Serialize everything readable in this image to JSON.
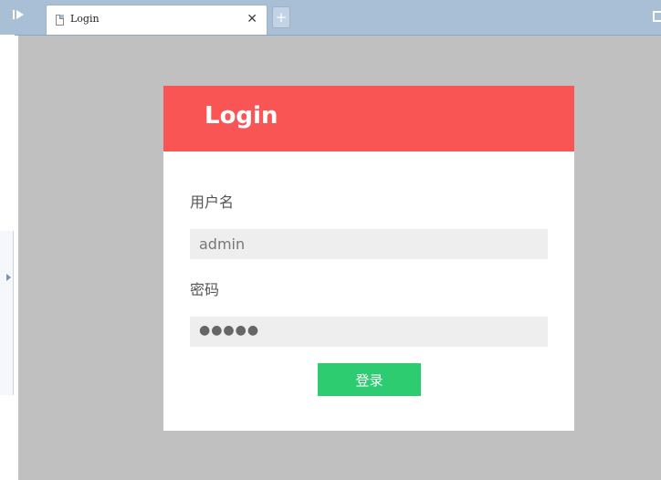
{
  "browser": {
    "tab_title": "Login",
    "tab_close": "✕",
    "new_tab": "+",
    "sidebar_toggle": "▶"
  },
  "login": {
    "title": "Login",
    "username_label": "用户名",
    "username_value": "admin",
    "password_label": "密码",
    "password_mask": "●●●●●",
    "submit_label": "登录"
  },
  "colors": {
    "header": "#fa5555",
    "button": "#2ecc71",
    "backdrop": "#c0c0c0",
    "input_bg": "#eeeeee"
  },
  "icons": [
    "sidebar-toggle-icon",
    "document-icon",
    "close-icon",
    "plus-icon",
    "window-icon",
    "arrow-right-icon"
  ]
}
